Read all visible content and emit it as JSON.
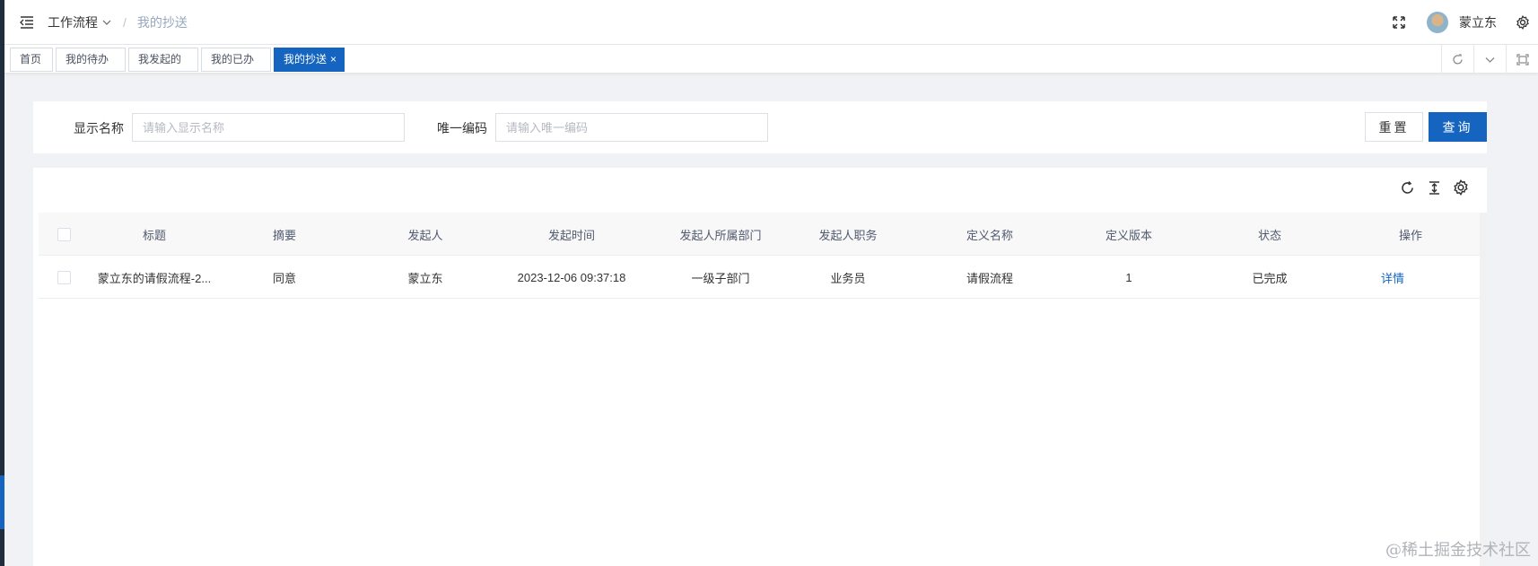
{
  "breadcrumb": {
    "parent": "工作流程",
    "current": "我的抄送"
  },
  "user": {
    "name": "蒙立东"
  },
  "tags": [
    {
      "label": "首页"
    },
    {
      "label": "我的待办"
    },
    {
      "label": "我发起的"
    },
    {
      "label": "我的已办"
    },
    {
      "label": "我的抄送",
      "active": true,
      "close": "×"
    }
  ],
  "search": {
    "display_name_label": "显示名称",
    "display_name_placeholder": "请输入显示名称",
    "code_label": "唯一编码",
    "code_placeholder": "请输入唯一编码",
    "reset_label": "重置",
    "query_label": "查询"
  },
  "table": {
    "columns": [
      "标题",
      "摘要",
      "发起人",
      "发起时间",
      "发起人所属部门",
      "发起人职务",
      "定义名称",
      "定义版本",
      "状态",
      "操作"
    ],
    "rows": [
      {
        "title": "蒙立东的请假流程-2...",
        "summary": "同意",
        "initiator": "蒙立东",
        "time": "2023-12-06 09:37:18",
        "department": "一级子部门",
        "position": "业务员",
        "definition": "请假流程",
        "version": "1",
        "status": "已完成",
        "action": "详情"
      }
    ]
  },
  "watermark": "@稀土掘金技术社区",
  "colors": {
    "primary": "#1565c0",
    "sidebar": "#1f2d3d"
  }
}
